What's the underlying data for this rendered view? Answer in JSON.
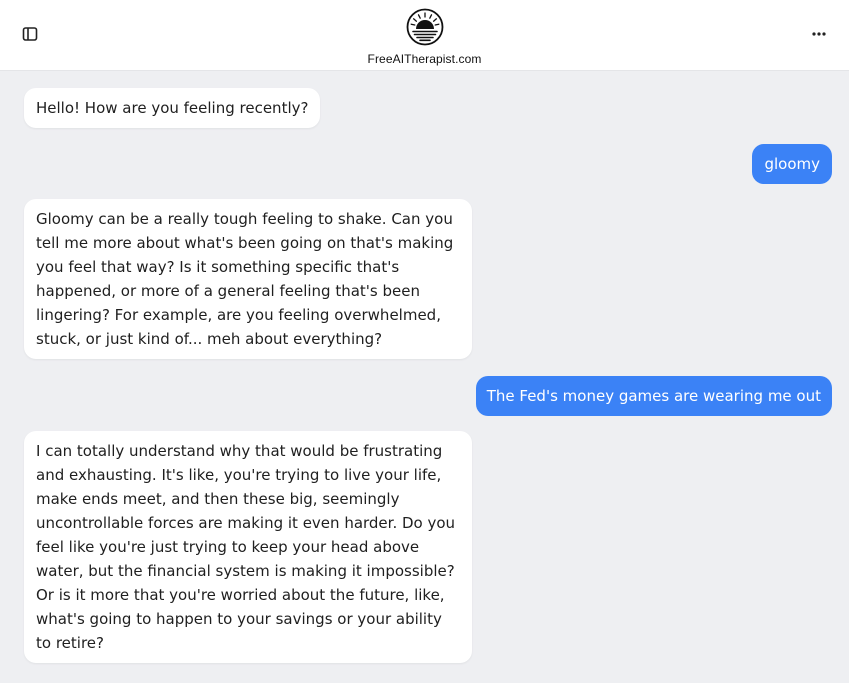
{
  "header": {
    "site_name": "FreeAITherapist.com",
    "sidebar_toggle_icon": "sidebar-panel-icon",
    "more_icon": "more-horizontal-icon",
    "logo_icon": "sunrise-logo-icon"
  },
  "colors": {
    "user_bubble": "#3b82f6",
    "bot_bubble": "#ffffff",
    "background": "#eeeff2"
  },
  "messages": [
    {
      "role": "assistant",
      "text": "Hello! How are you feeling recently?"
    },
    {
      "role": "user",
      "text": "gloomy"
    },
    {
      "role": "assistant",
      "text": "Gloomy can be a really tough feeling to shake. Can you tell me more about what's been going on that's making you feel that way? Is it something specific that's happened, or more of a general feeling that's been lingering? For example, are you feeling overwhelmed, stuck, or just kind of... meh about everything?"
    },
    {
      "role": "user",
      "text": "The Fed's money games are wearing me out"
    },
    {
      "role": "assistant",
      "text": "I can totally understand why that would be frustrating and exhausting. It's like, you're trying to live your life, make ends meet, and then these big, seemingly uncontrollable forces are making it even harder. Do you feel like you're just trying to keep your head above water, but the financial system is making it impossible? Or is it more that you're worried about the future, like, what's going to happen to your savings or your ability to retire?"
    }
  ]
}
